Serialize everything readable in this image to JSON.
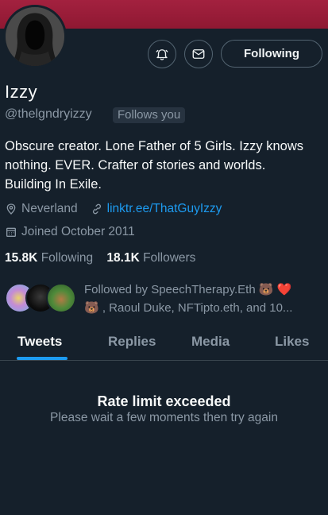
{
  "profile": {
    "name": "Izzy",
    "handle": "@thelgndryizzy",
    "follows_you": "Follows you",
    "bio": "Obscure creator. Lone Father of 5 Girls. Izzy knows nothing. EVER. Crafter of stories and worlds. Building In Exile.",
    "location": "Neverland",
    "website": "linktr.ee/ThatGuyIzzy",
    "joined": "Joined October 2011"
  },
  "actions": {
    "notify_icon": "bell-icon",
    "message_icon": "envelope-icon",
    "follow_label": "Following"
  },
  "stats": {
    "following_count": "15.8K",
    "following_label": "Following",
    "followers_count": "18.1K",
    "followers_label": "Followers"
  },
  "followed_by": {
    "line1": "Followed by SpeechTherapy.Eth 🐻 ❤️",
    "line2": "🐻 , Raoul Duke, NFTipto.eth, and 10..."
  },
  "tabs": [
    {
      "label": "Tweets",
      "active": true
    },
    {
      "label": "Replies",
      "active": false
    },
    {
      "label": "Media",
      "active": false
    },
    {
      "label": "Likes",
      "active": false
    }
  ],
  "empty_state": {
    "title": "Rate limit exceeded",
    "subtitle": "Please wait a few moments then try again"
  },
  "colors": {
    "background": "#15202b",
    "banner": "#a3213f",
    "accent": "#1d9bf0",
    "muted": "#8b98a5"
  }
}
